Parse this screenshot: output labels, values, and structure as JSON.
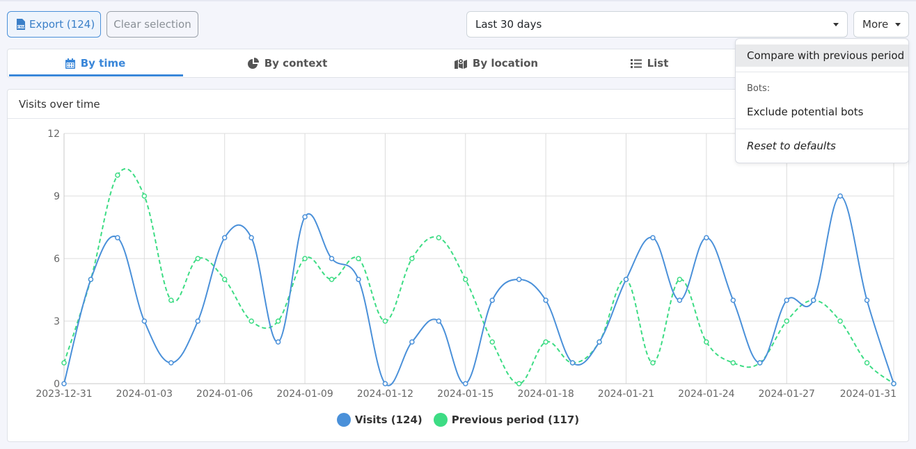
{
  "toolbar": {
    "export_label": "Export (124)",
    "clear_label": "Clear selection",
    "period_value": "Last 30 days",
    "more_label": "More"
  },
  "tabs": [
    {
      "label": "By time",
      "icon": "calendar-icon",
      "active": true
    },
    {
      "label": "By context",
      "icon": "pie-chart-icon",
      "active": false
    },
    {
      "label": "By location",
      "icon": "map-icon",
      "active": false
    },
    {
      "label": "List",
      "icon": "list-icon",
      "active": false
    }
  ],
  "card": {
    "title": "Visits over time"
  },
  "dropdown": {
    "compare": "Compare with previous period",
    "bots_header": "Bots:",
    "exclude_bots": "Exclude potential bots",
    "reset": "Reset to defaults"
  },
  "colors": {
    "accent": "#3a87d9",
    "visits": "#4a90d9",
    "previous": "#3ddc84"
  },
  "chart_data": {
    "type": "line",
    "x": [
      "2023-12-31",
      "2024-01-01",
      "2024-01-02",
      "2024-01-03",
      "2024-01-04",
      "2024-01-05",
      "2024-01-06",
      "2024-01-07",
      "2024-01-08",
      "2024-01-09",
      "2024-01-10",
      "2024-01-11",
      "2024-01-12",
      "2024-01-13",
      "2024-01-14",
      "2024-01-15",
      "2024-01-16",
      "2024-01-17",
      "2024-01-18",
      "2024-01-19",
      "2024-01-20",
      "2024-01-21",
      "2024-01-22",
      "2024-01-23",
      "2024-01-24",
      "2024-01-25",
      "2024-01-26",
      "2024-01-27",
      "2024-01-28",
      "2024-01-29",
      "2024-01-30",
      "2024-01-31"
    ],
    "xticks": [
      "2023-12-31",
      "2024-01-03",
      "2024-01-06",
      "2024-01-09",
      "2024-01-12",
      "2024-01-15",
      "2024-01-18",
      "2024-01-21",
      "2024-01-24",
      "2024-01-27",
      "2024-01-31"
    ],
    "yticks": [
      0,
      3,
      6,
      9,
      12
    ],
    "ylim": [
      0,
      12
    ],
    "series": [
      {
        "name": "Visits (124)",
        "color": "#4a90d9",
        "dashed": false,
        "values": [
          0,
          5,
          7,
          3,
          1,
          3,
          7,
          7,
          2,
          8,
          6,
          5,
          0,
          2,
          3,
          0,
          4,
          5,
          4,
          1,
          2,
          5,
          7,
          4,
          7,
          4,
          1,
          4,
          4,
          9,
          4,
          0
        ]
      },
      {
        "name": "Previous period (117)",
        "color": "#3ddc84",
        "dashed": true,
        "values": [
          1,
          5,
          10,
          9,
          4,
          6,
          5,
          3,
          3,
          6,
          5,
          6,
          3,
          6,
          7,
          5,
          2,
          0,
          2,
          1,
          2,
          5,
          1,
          5,
          2,
          1,
          1,
          3,
          4,
          3,
          1,
          0
        ]
      }
    ],
    "grid": true,
    "legend": "bottom"
  }
}
